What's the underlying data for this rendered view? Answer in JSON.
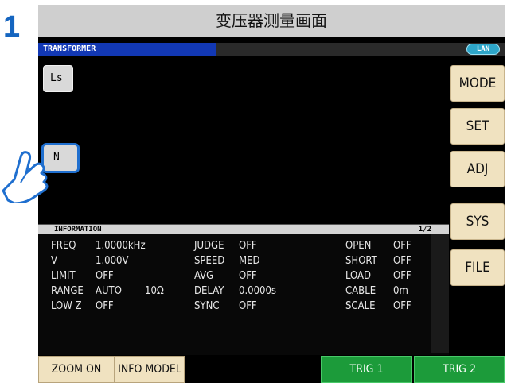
{
  "step": {
    "number": "1",
    "caption": "变压器测量画面"
  },
  "header": {
    "title": "TRANSFORMER",
    "lan_badge": "LAN"
  },
  "params": {
    "ls": "Ls",
    "n": "N"
  },
  "side_menu": [
    "MODE",
    "SET",
    "ADJ",
    "SYS",
    "FILE"
  ],
  "info": {
    "title": "INFORMATION",
    "page": "1/2",
    "rows": [
      [
        {
          "k": "FREQ",
          "v": "1.0000kHz"
        },
        {
          "k": "JUDGE",
          "v": "OFF"
        },
        {
          "k": "OPEN",
          "v": "OFF"
        }
      ],
      [
        {
          "k": "V",
          "v": "1.000V"
        },
        {
          "k": "SPEED",
          "v": "MED"
        },
        {
          "k": "SHORT",
          "v": "OFF"
        }
      ],
      [
        {
          "k": "LIMIT",
          "v": "OFF"
        },
        {
          "k": "AVG",
          "v": "OFF"
        },
        {
          "k": "LOAD",
          "v": "OFF"
        }
      ],
      [
        {
          "k": "RANGE",
          "v": "AUTO",
          "extra": "10Ω"
        },
        {
          "k": "DELAY",
          "v": "0.0000s"
        },
        {
          "k": "CABLE",
          "v": "0m"
        }
      ],
      [
        {
          "k": "LOW Z",
          "v": "OFF"
        },
        {
          "k": "SYNC",
          "v": "OFF"
        },
        {
          "k": "SCALE",
          "v": "OFF"
        }
      ]
    ]
  },
  "bottom": {
    "zoom": "ZOOM ON",
    "info_model": "INFO MODEL",
    "trig1": "TRIG 1",
    "trig2": "TRIG 2"
  },
  "colors": {
    "accent_blue": "#1238b4",
    "trigger_green": "#1c9b3a",
    "button_beige": "#f0e2c0",
    "highlight_blue": "#1f6fcf"
  }
}
